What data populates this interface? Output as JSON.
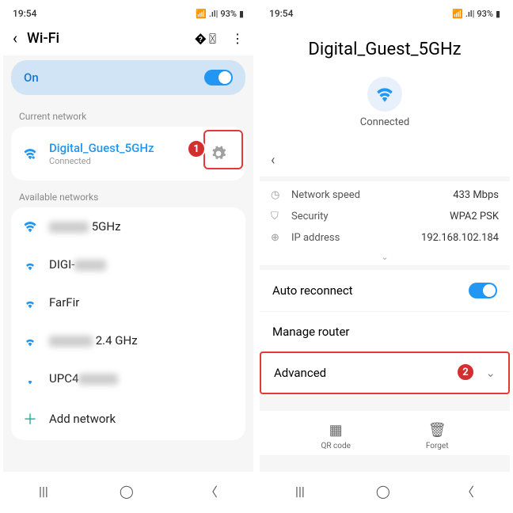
{
  "status": {
    "time": "19:54",
    "battery": "93%"
  },
  "left": {
    "title": "Wi-Fi",
    "toggle": "On",
    "section1": "Current network",
    "current": {
      "name": "Digital_Guest_5GHz",
      "sub": "Connected"
    },
    "section2": "Available networks",
    "nets": [
      {
        "suffix": "5GHz"
      },
      {
        "prefix": "DIGI-"
      },
      {
        "name": "FarFir"
      },
      {
        "suffix": "2.4 GHz"
      },
      {
        "prefix": "UPC4"
      }
    ],
    "add": "Add network",
    "callout": "1"
  },
  "right": {
    "title": "Digital_Guest_5GHz",
    "connected": "Connected",
    "speed_k": "Network speed",
    "speed_v": "433 Mbps",
    "sec_k": "Security",
    "sec_v": "WPA2 PSK",
    "ip_k": "IP address",
    "ip_v": "192.168.102.184",
    "auto": "Auto reconnect",
    "manage": "Manage router",
    "advanced": "Advanced",
    "qr": "QR code",
    "forget": "Forget",
    "callout": "2"
  }
}
